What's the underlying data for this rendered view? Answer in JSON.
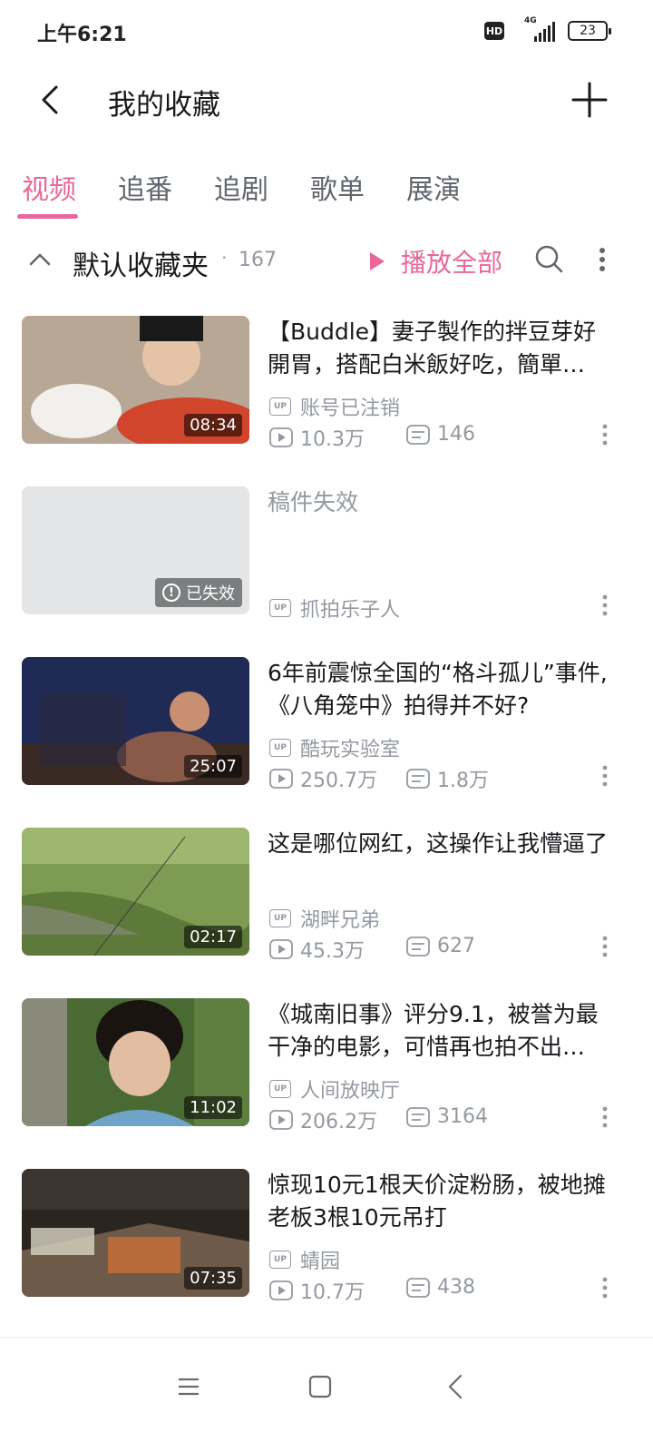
{
  "status_bar": {
    "time": "上午6:21",
    "hd": "HD",
    "network": "4G",
    "battery": "23"
  },
  "header": {
    "title": "我的收藏"
  },
  "tabs": [
    {
      "label": "视频",
      "active": true
    },
    {
      "label": "追番"
    },
    {
      "label": "追剧"
    },
    {
      "label": "歌单"
    },
    {
      "label": "展演"
    }
  ],
  "folder": {
    "name": "默认收藏夹",
    "separator": "·",
    "count": "167",
    "play_all_label": "播放全部"
  },
  "videos": [
    {
      "title": "【Buddle】妻子製作的拌豆芽好開胃，搭配白米飯好吃，簡單…",
      "uploader": "账号已注销",
      "views": "10.3万",
      "danmaku": "146",
      "duration": "08:34",
      "thumb_colors": [
        "#c9b8a8",
        "#d0452c"
      ]
    },
    {
      "title": "稿件失效",
      "uploader": "抓拍乐子人",
      "invalid_label": "已失效",
      "invalid": true
    },
    {
      "title": "6年前震惊全国的“格斗孤儿”事件,《八角笼中》拍得并不好?",
      "uploader": "酷玩实验室",
      "views": "250.7万",
      "danmaku": "1.8万",
      "duration": "25:07",
      "thumb_colors": [
        "#1f2a55",
        "#6a3c3c"
      ]
    },
    {
      "title": "这是哪位网红，这操作让我懵逼了",
      "uploader": "湖畔兄弟",
      "views": "45.3万",
      "danmaku": "627",
      "duration": "02:17",
      "thumb_colors": [
        "#6c8f45",
        "#8aa85e"
      ]
    },
    {
      "title": "《城南旧事》评分9.1，被誉为最干净的电影，可惜再也拍不出…",
      "uploader": "人间放映厅",
      "views": "206.2万",
      "danmaku": "3164",
      "duration": "11:02",
      "thumb_colors": [
        "#3d5a2c",
        "#c7a38a"
      ]
    },
    {
      "title": "惊现10元1根天价淀粉肠，被地摊老板3根10元吊打",
      "uploader": "蜻园",
      "views": "10.7万",
      "danmaku": "438",
      "duration": "07:35",
      "thumb_colors": [
        "#2b2520",
        "#b86a3a"
      ]
    }
  ],
  "icons": {
    "back": "chevron-left-icon",
    "add": "plus-icon",
    "collapse": "chevron-up-icon",
    "search": "search-icon",
    "more": "more-vertical-icon",
    "up": "up-badge-icon",
    "play": "play-count-icon",
    "danmaku": "danmaku-icon"
  },
  "colors": {
    "accent": "#e9679a",
    "text": "#18191c",
    "secondary": "#9499a0"
  }
}
